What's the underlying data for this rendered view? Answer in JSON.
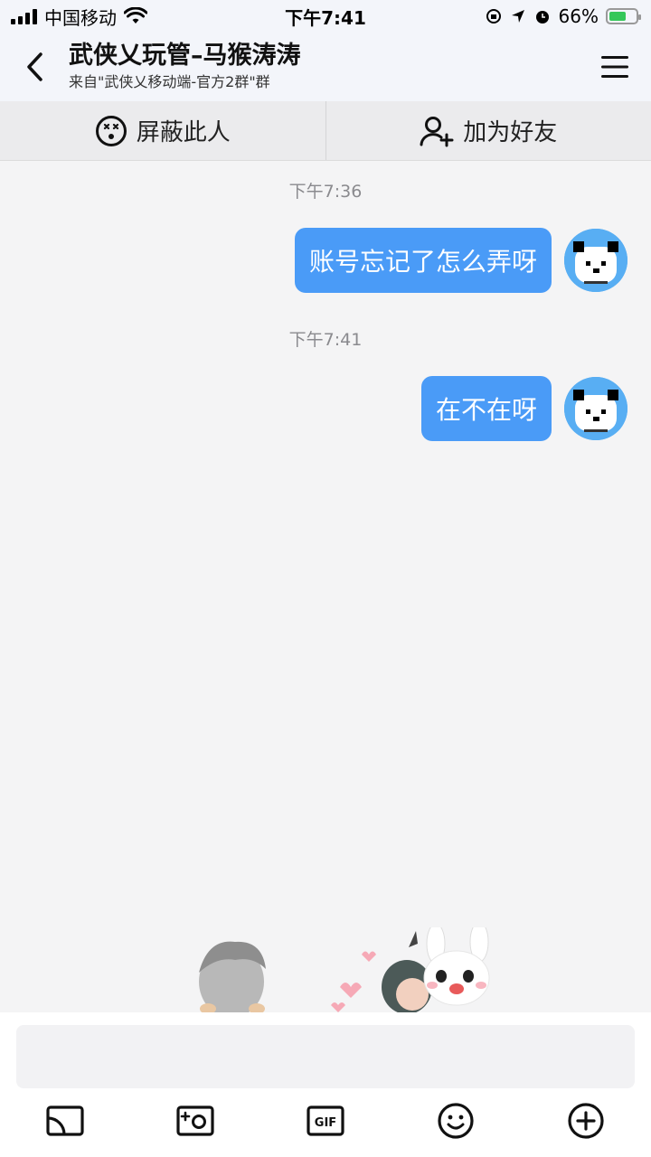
{
  "status_bar": {
    "carrier": "中国移动",
    "time": "下午7:41",
    "battery_percent": "66%",
    "battery_level": 0.66
  },
  "header": {
    "title": "武侠乂玩管–马猴涛涛",
    "subtitle": "来自\"武侠乂移动端-官方2群\"群"
  },
  "actions": {
    "block_label": "屏蔽此人",
    "add_friend_label": "加为好友"
  },
  "messages": [
    {
      "time": "下午7:36",
      "text": "账号忘记了怎么弄呀"
    },
    {
      "time": "下午7:41",
      "text": "在不在呀"
    }
  ],
  "input": {
    "placeholder": "",
    "value": ""
  },
  "toolbar": [
    "screen-cast-icon",
    "camera-icon",
    "gif-icon",
    "emoji-icon",
    "plus-icon"
  ],
  "colors": {
    "bubble": "#4a9bf7",
    "avatar_bg": "#58aef3",
    "battery": "#34c759"
  }
}
